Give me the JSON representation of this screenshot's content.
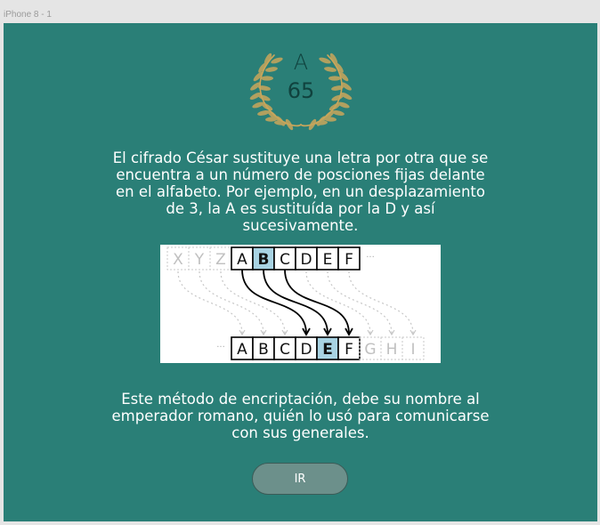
{
  "frame": {
    "label": "iPhone 8 - 1"
  },
  "colors": {
    "background": "#2a7f77",
    "canvas": "#e5e5e5",
    "laurel": "#c9a65b",
    "highlight": "#a8d3e3",
    "button": "#6c908b"
  },
  "emblem": {
    "letter": "A",
    "code": "65"
  },
  "intro": {
    "text": "El cifrado César sustituye una letra por otra que se encuentra a un número de posciones fijas delante en el alfabeto. Por ejemplo, en un desplazamiento de 3, la A es sustituída por la D y así sucesivamente."
  },
  "diagram": {
    "top_faded_left": [
      "X",
      "Y",
      "Z"
    ],
    "top_letters": [
      "A",
      "B",
      "C",
      "D",
      "E",
      "F"
    ],
    "top_highlight": "B",
    "bottom_letters": [
      "A",
      "B",
      "C",
      "D",
      "E",
      "F"
    ],
    "bottom_highlight": "E",
    "bottom_faded_right": [
      "G",
      "H",
      "I"
    ],
    "shift": 3
  },
  "closing": {
    "text": "Este método de encriptación, debe su nombre al emperador romano, quién lo usó para comunicarse con sus generales."
  },
  "button": {
    "label": "IR"
  }
}
